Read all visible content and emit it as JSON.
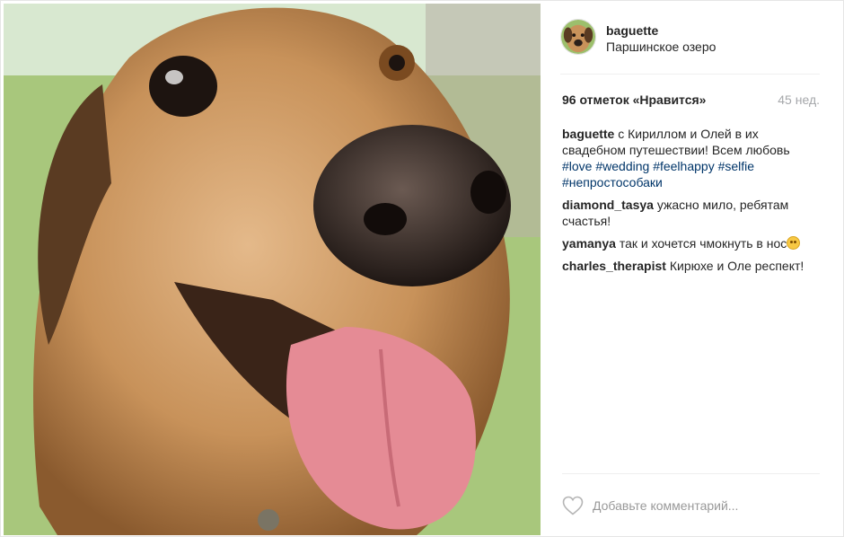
{
  "post": {
    "author": "baguette",
    "location": "Паршинское озеро",
    "likes_text": "96 отметок «Нравится»",
    "time_ago": "45 нед."
  },
  "caption": {
    "author": "baguette",
    "text": " с Кириллом и Олей в их свадебном путешествии! Всем любовь ",
    "tags": [
      "#love",
      "#wedding",
      "#feelhappy",
      "#selfie",
      "#непростособаки"
    ]
  },
  "comments": [
    {
      "author": "diamond_tasya",
      "text": " ужасно мило, ребятам счастья!"
    },
    {
      "author": "yamanya",
      "text": " так и хочется чмокнуть в нос"
    },
    {
      "author": "charles_therapist",
      "text": " Кирюхе и Оле респект!"
    }
  ],
  "footer": {
    "comment_placeholder": "Добавьте комментарий..."
  },
  "icons": {
    "like": "heart-outline-icon",
    "emoji": "blush-emoji-icon"
  },
  "colors": {
    "hashtag": "#003569",
    "muted": "#a5a7aa",
    "text": "#262626"
  }
}
